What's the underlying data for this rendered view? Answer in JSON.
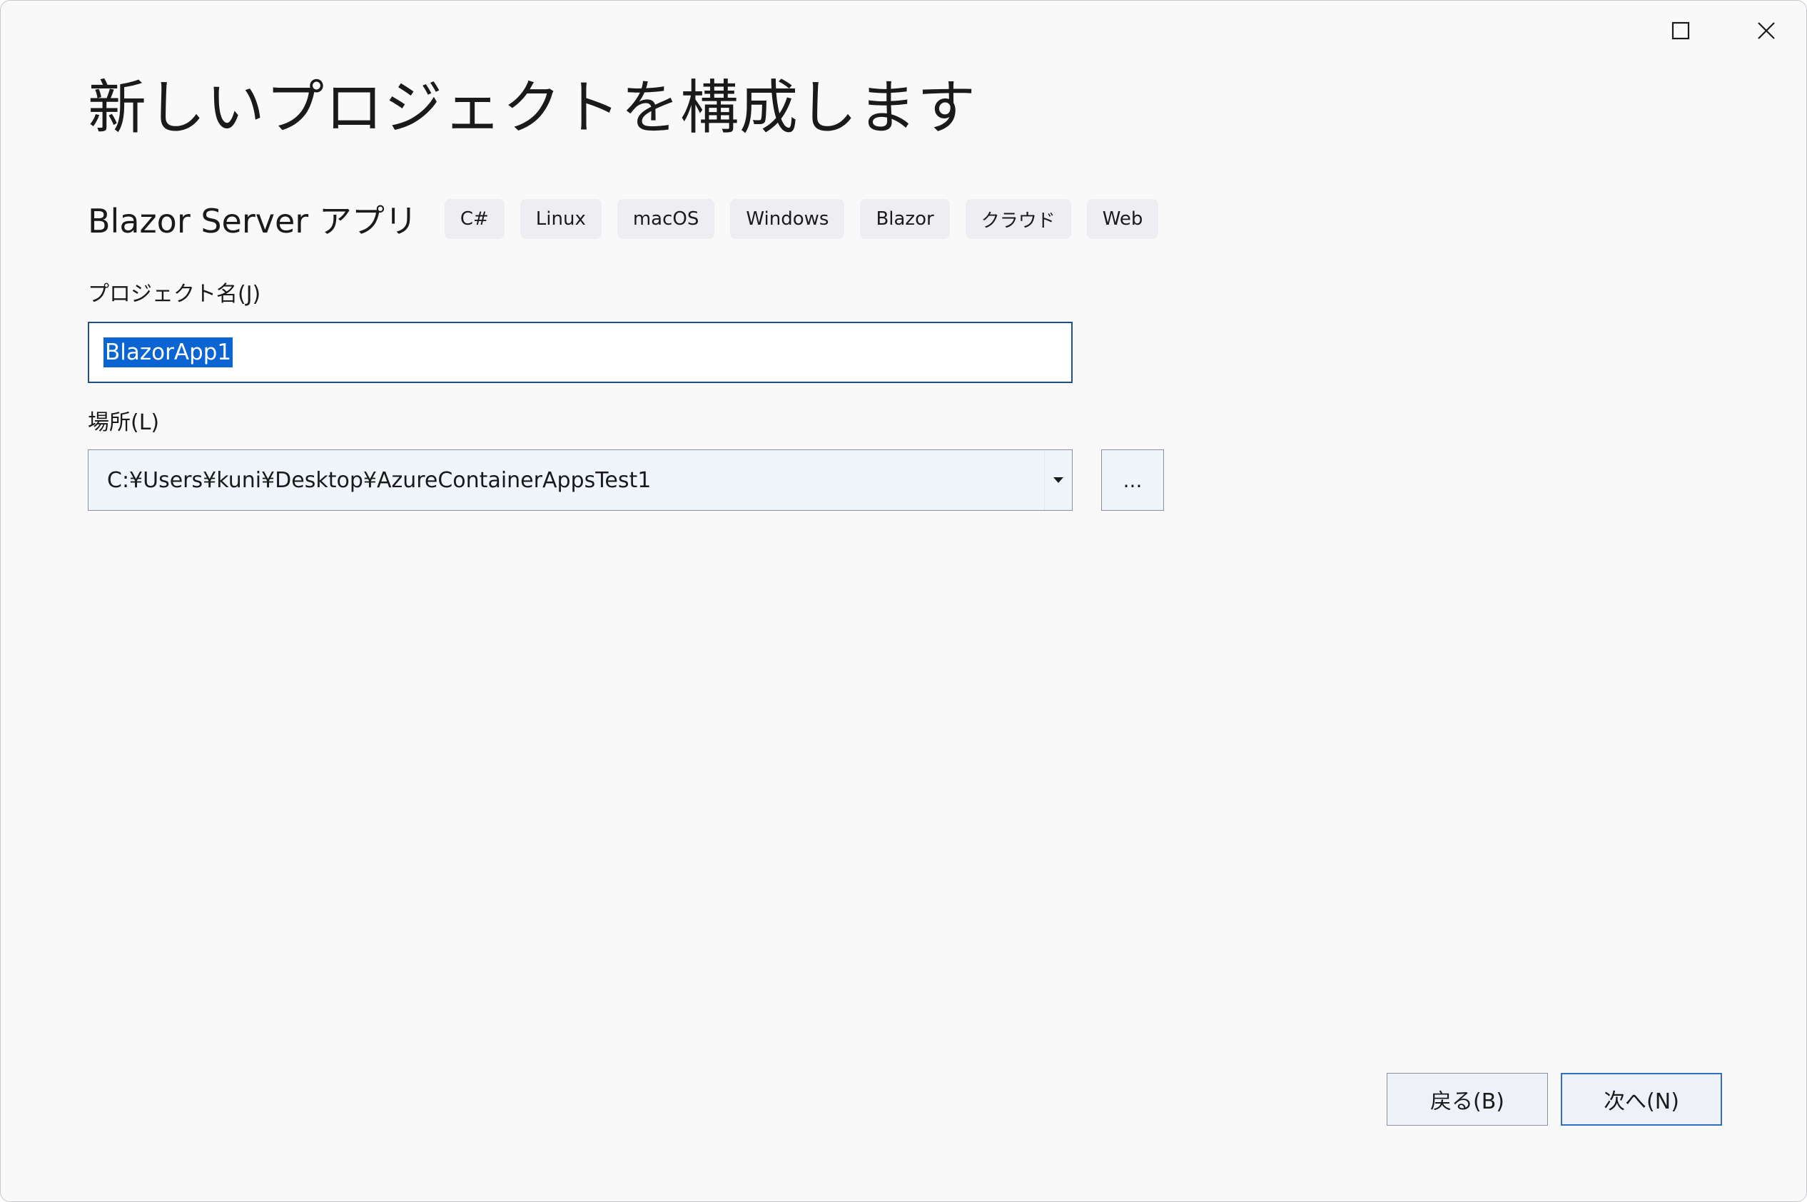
{
  "window": {
    "maximize_icon": "maximize-icon",
    "close_icon": "close-icon"
  },
  "page": {
    "title": "新しいプロジェクトを構成します"
  },
  "template": {
    "name": "Blazor Server アプリ",
    "tags": [
      "C#",
      "Linux",
      "macOS",
      "Windows",
      "Blazor",
      "クラウド",
      "Web"
    ]
  },
  "project_name": {
    "label": "プロジェクト名(J)",
    "value": "BlazorApp1"
  },
  "location": {
    "label": "場所(L)",
    "value": "C:¥Users¥kuni¥Desktop¥AzureContainerAppsTest1",
    "dropdown_icon": "chevron-down-icon",
    "browse_label": "..."
  },
  "footer": {
    "back_label": "戻る(B)",
    "next_label": "次へ(N)"
  },
  "colors": {
    "background": "#f9f9f9",
    "selection": "#0a64d1",
    "focus_border": "#1f4f8f",
    "primary_button_border": "#2d6fc2"
  }
}
